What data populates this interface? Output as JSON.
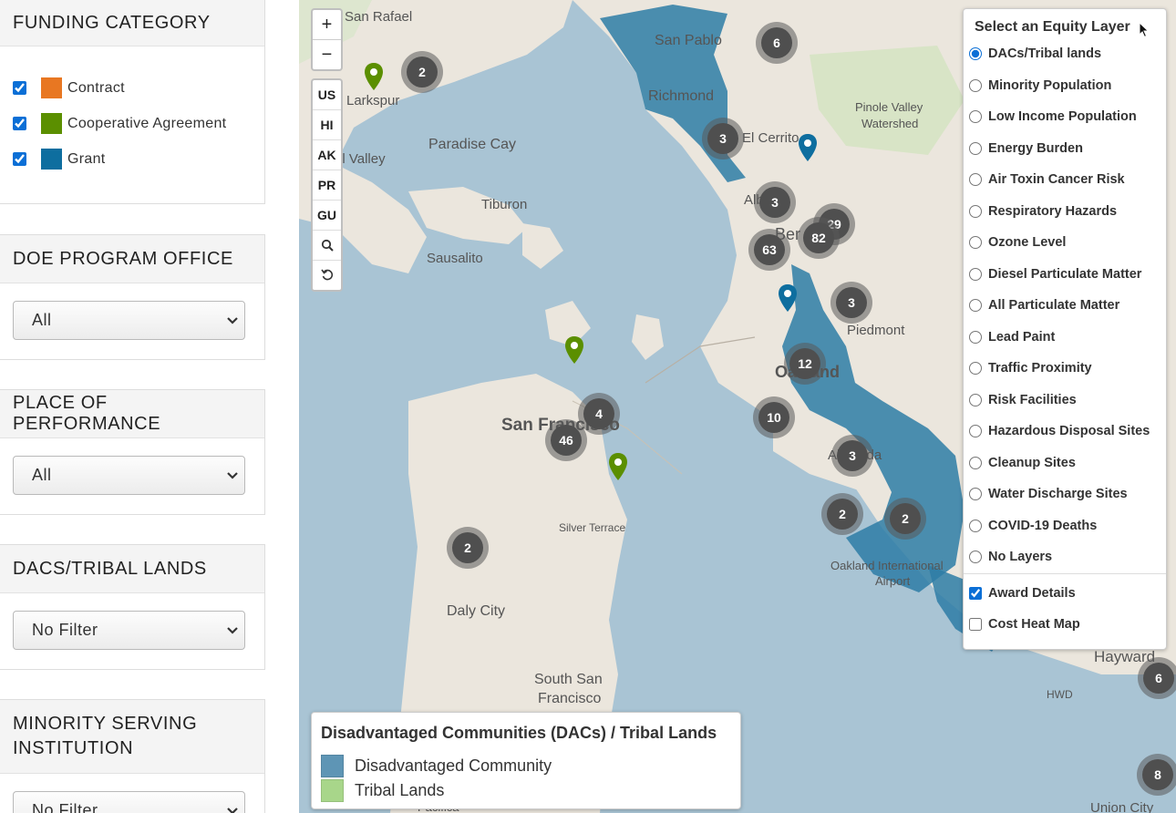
{
  "sidebar": {
    "funding": {
      "title": "FUNDING CATEGORY",
      "items": [
        {
          "label": "Contract",
          "checked": true,
          "color": "#e87722"
        },
        {
          "label": "Cooperative Agreement",
          "checked": true,
          "color": "#5b8f00"
        },
        {
          "label": "Grant",
          "checked": true,
          "color": "#0e6e9f"
        }
      ]
    },
    "program_office": {
      "title": "DOE PROGRAM OFFICE",
      "value": "All"
    },
    "place": {
      "title": "PLACE OF PERFORMANCE",
      "value": "All"
    },
    "dacs": {
      "title": "DACS/TRIBAL LANDS",
      "value": "No Filter"
    },
    "msi": {
      "title_line1": "MINORITY SERVING",
      "title_line2": "INSTITUTION",
      "value": "No Filter"
    }
  },
  "map": {
    "zoom_in": "+",
    "zoom_out": "−",
    "regions": [
      "US",
      "HI",
      "AK",
      "PR",
      "GU"
    ],
    "places": {
      "san_rafael": "San Rafael",
      "larkspur": "Larkspur",
      "paradise_cay": "Paradise Cay",
      "mill_valley": "ll Valley",
      "tiburon": "Tiburon",
      "sausalito": "Sausalito",
      "san_pablo": "San Pablo",
      "richmond": "Richmond",
      "el_cerrito": "El Cerrito",
      "albany": "Alba",
      "berkeley": "Ber",
      "pinole1": "Pinole Valley",
      "pinole2": "Watershed",
      "piedmont": "Piedmont",
      "oakland": "Oakland",
      "alameda": "Alameda",
      "san_francisco": "San Francisco",
      "silver_terrace": "Silver Terrace",
      "daly_city": "Daly City",
      "ssf1": "South San",
      "ssf2": "Francisco",
      "oak_airport1": "Oakland International",
      "oak_airport2": "Airport",
      "hayward": "Hayward",
      "hwd": "HWD",
      "union_city": "Union City",
      "pacifica": "Pacifica"
    },
    "clusters": [
      {
        "id": "c1",
        "count": "2"
      },
      {
        "id": "c2",
        "count": "6"
      },
      {
        "id": "c3",
        "count": "3"
      },
      {
        "id": "c4",
        "count": "3"
      },
      {
        "id": "c5",
        "count": "29"
      },
      {
        "id": "c6",
        "count": "82"
      },
      {
        "id": "c7",
        "count": "63"
      },
      {
        "id": "c8",
        "count": "3"
      },
      {
        "id": "c9",
        "count": "12"
      },
      {
        "id": "c10",
        "count": "10"
      },
      {
        "id": "c11",
        "count": "4"
      },
      {
        "id": "c12",
        "count": "46"
      },
      {
        "id": "c13",
        "count": "3"
      },
      {
        "id": "c14",
        "count": "2"
      },
      {
        "id": "c15",
        "count": "2"
      },
      {
        "id": "c16",
        "count": "2"
      },
      {
        "id": "c17",
        "count": "6"
      },
      {
        "id": "c18",
        "count": "8"
      }
    ],
    "layer_panel": {
      "title": "Select an Equity Layer",
      "layers": [
        "DACs/Tribal lands",
        "Minority Population",
        "Low Income Population",
        "Energy Burden",
        "Air Toxin Cancer Risk",
        "Respiratory Hazards",
        "Ozone Level",
        "Diesel Particulate Matter",
        "All Particulate Matter",
        "Lead Paint",
        "Traffic Proximity",
        "Risk Facilities",
        "Hazardous Disposal Sites",
        "Cleanup Sites",
        "Water Discharge Sites",
        "COVID-19 Deaths",
        "No Layers"
      ],
      "selected_layer": "DACs/Tribal lands",
      "award_details": "Award Details",
      "cost_heat_map": "Cost Heat Map"
    },
    "legend": {
      "title": "Disadvantaged Communities (DACs) / Tribal Lands",
      "items": [
        {
          "label": "Disadvantaged Community",
          "color": "#5e95b5"
        },
        {
          "label": "Tribal Lands",
          "color": "#a8d68a"
        }
      ]
    }
  }
}
